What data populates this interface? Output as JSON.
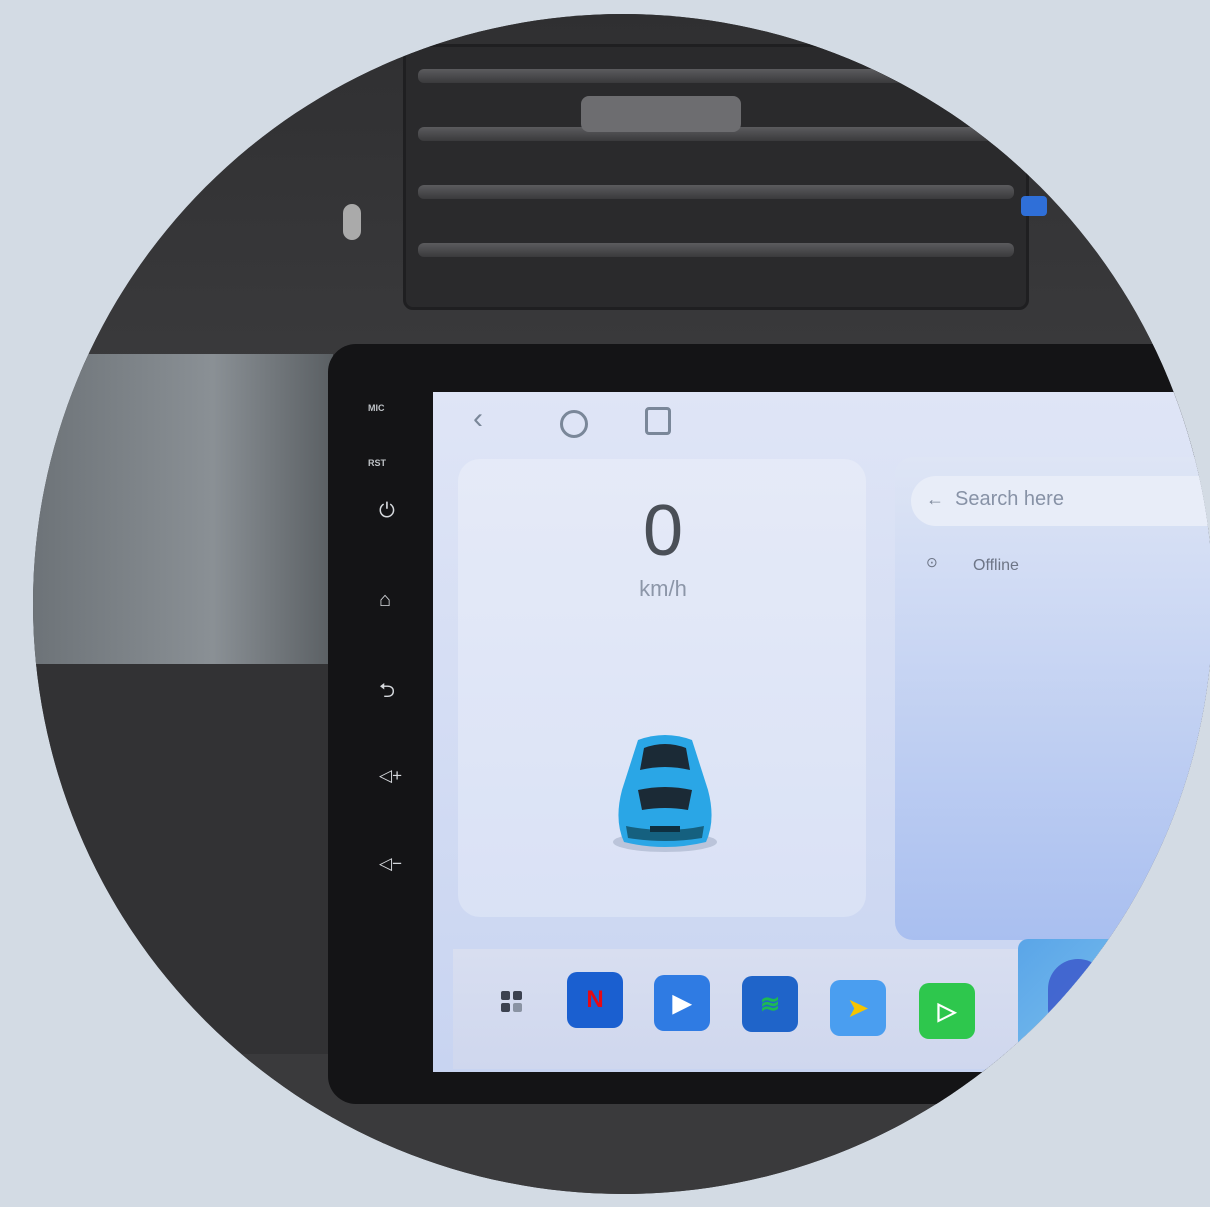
{
  "side_buttons": {
    "mic_label": "MIC",
    "rst_label": "RST"
  },
  "speed": {
    "value": "0",
    "unit": "km/h"
  },
  "search": {
    "placeholder": "Search here"
  },
  "status": {
    "text": "Offline"
  },
  "icons": [
    "back-icon",
    "home-icon",
    "recents-icon",
    "power-icon",
    "home-button-icon",
    "return-icon",
    "volume-up-icon",
    "volume-down-icon",
    "apps-grid-icon"
  ],
  "apps": [
    {
      "name": "netflix-icon",
      "color": "#1a5fd0",
      "glyph": "N",
      "glyph_color": "#e50914"
    },
    {
      "name": "youtube-icon",
      "color": "#2f7be3",
      "glyph": "▶",
      "glyph_color": "#ffffff"
    },
    {
      "name": "spotify-icon",
      "color": "#1f64c9",
      "glyph": "≋",
      "glyph_color": "#1db954"
    },
    {
      "name": "navigation-icon",
      "color": "#4a9ef0",
      "glyph": "➤",
      "glyph_color": "#f5c400"
    },
    {
      "name": "carplay-icon",
      "color": "#2ec74d",
      "glyph": "▷",
      "glyph_color": "#ffffff"
    }
  ],
  "colors": {
    "car": "#2aa6e6",
    "background": "#d3dbe4"
  }
}
